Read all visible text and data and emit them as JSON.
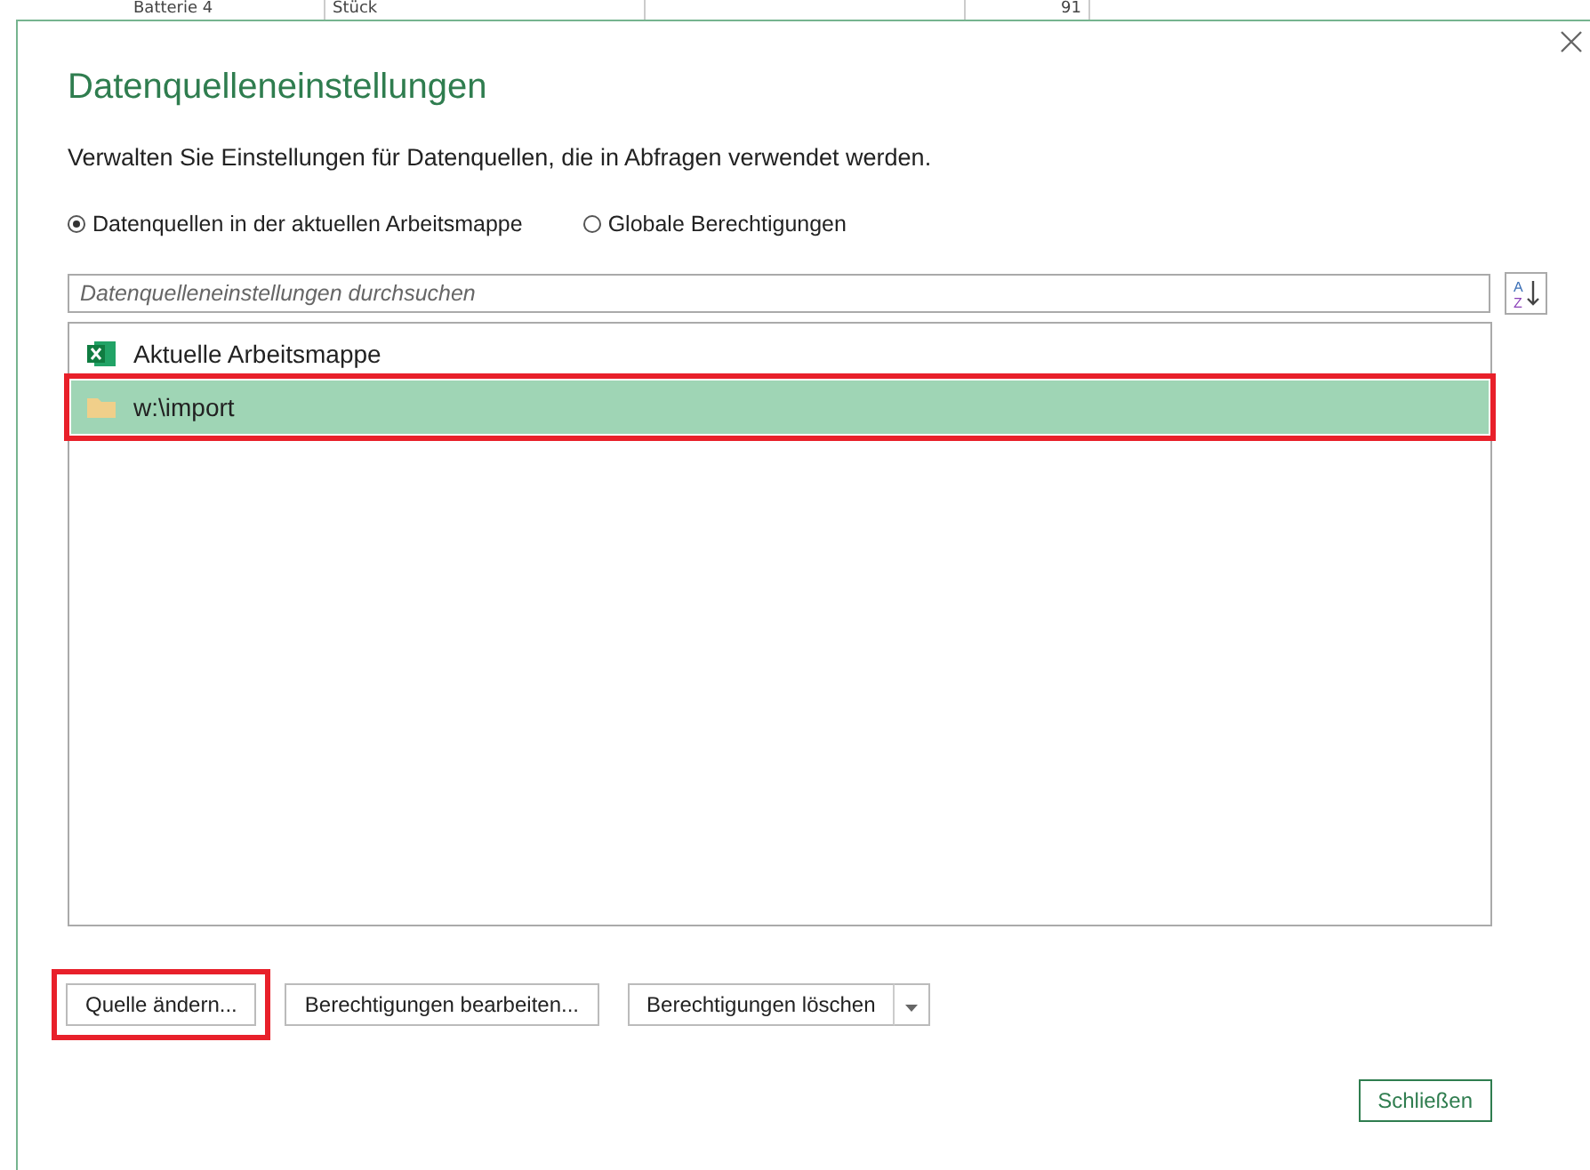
{
  "sheet_row": {
    "cells": [
      "Batterie 4",
      "Stück",
      "",
      "91"
    ]
  },
  "dialog": {
    "title": "Datenquelleneinstellungen",
    "description": "Verwalten Sie Einstellungen für Datenquellen, die in Abfragen verwendet werden.",
    "scope_options": [
      {
        "label": "Datenquellen in der aktuellen Arbeitsmappe",
        "selected": true
      },
      {
        "label": "Globale Berechtigungen",
        "selected": false
      }
    ],
    "search": {
      "placeholder": "Datenquelleneinstellungen durchsuchen"
    },
    "sort_button": {
      "top": "A",
      "bottom": "Z"
    },
    "sources": [
      {
        "kind": "excel",
        "label": "Aktuelle Arbeitsmappe",
        "selected": false,
        "highlighted": false
      },
      {
        "kind": "folder",
        "label": "w:\\import",
        "selected": true,
        "highlighted": true
      }
    ],
    "buttons": [
      {
        "label": "Quelle ändern...",
        "highlighted": true,
        "dropdown": false
      },
      {
        "label": "Berechtigungen bearbeiten...",
        "highlighted": false,
        "dropdown": false
      },
      {
        "label": "Berechtigungen löschen",
        "highlighted": false,
        "dropdown": true
      }
    ],
    "close_button": "Schließen"
  }
}
